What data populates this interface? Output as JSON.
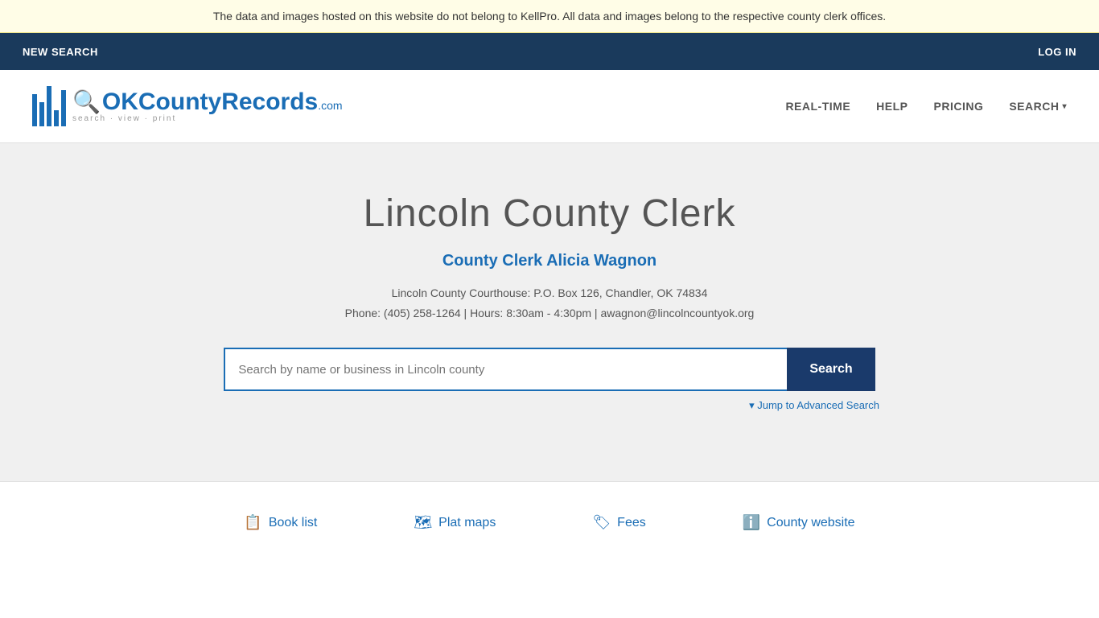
{
  "banner": {
    "text": "The data and images hosted on this website do not belong to KellPro. All data and images belong to the respective county clerk offices."
  },
  "navbar": {
    "new_search_label": "NEW SEARCH",
    "log_in_label": "LOG IN"
  },
  "header": {
    "logo_brand": "OKCountyRecords",
    "logo_dotcom": ".com",
    "logo_tagline": "search · view · print",
    "nav_items": [
      {
        "label": "REAL-TIME",
        "id": "real-time"
      },
      {
        "label": "HELP",
        "id": "help"
      },
      {
        "label": "PRICING",
        "id": "pricing"
      },
      {
        "label": "SEARCH",
        "id": "search",
        "has_dropdown": true
      }
    ]
  },
  "main": {
    "county_title": "Lincoln County Clerk",
    "clerk_name": "County Clerk Alicia Wagnon",
    "address_line1": "Lincoln County Courthouse: P.O. Box 126, Chandler, OK 74834",
    "address_line2": "Phone: (405) 258-1264 | Hours: 8:30am - 4:30pm | awagnon@lincolncountyok.org",
    "search_placeholder": "Search by name or business in Lincoln county",
    "search_button_label": "Search",
    "advanced_search_label": "▾ Jump to Advanced Search"
  },
  "footer": {
    "links": [
      {
        "label": "Book list",
        "icon": "📋",
        "id": "book-list"
      },
      {
        "label": "Plat maps",
        "icon": "🗺",
        "id": "plat-maps"
      },
      {
        "label": "Fees",
        "icon": "🏷",
        "id": "fees"
      },
      {
        "label": "County website",
        "icon": "ℹ",
        "id": "county-website"
      }
    ]
  }
}
